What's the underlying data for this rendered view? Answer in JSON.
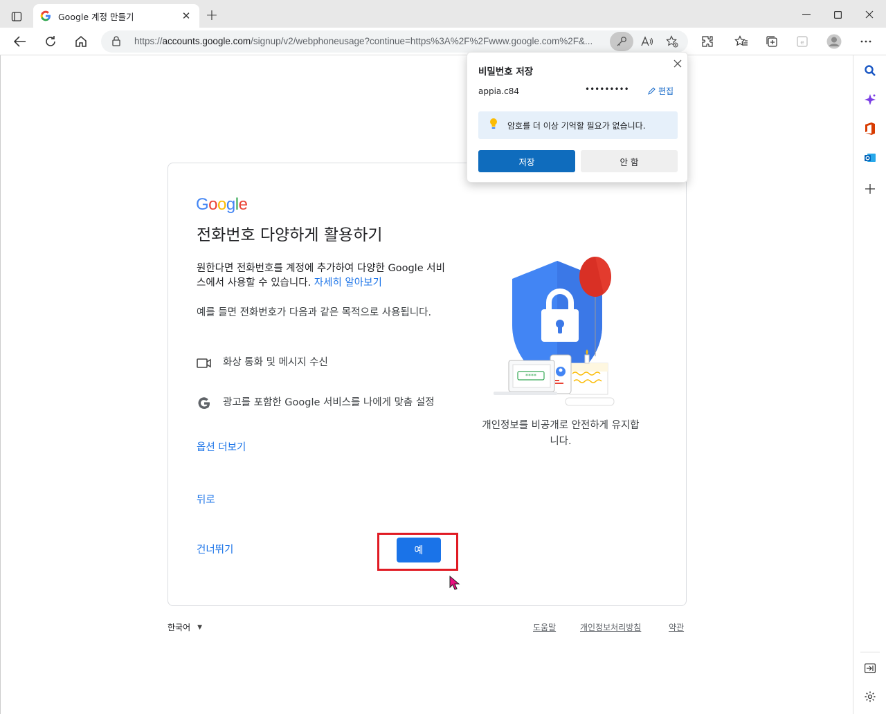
{
  "tab": {
    "title": "Google 계정 만들기"
  },
  "address": {
    "url_prefix": "https://",
    "url_host": "accounts.google.com",
    "url_rest": "/signup/v2/webphoneusage?continue=https%3A%2F%2Fwww.google.com%2F&..."
  },
  "page": {
    "logo": "Google",
    "heading": "전화번호 다양하게 활용하기",
    "intro": "원한다면 전화번호를 계정에 추가하여 다양한 Google 서비스에서 사용할 수 있습니다.",
    "learn_more": "자세히 알아보기",
    "example": "예를 들면 전화번호가 다음과 같은 목적으로 사용됩니다.",
    "features": [
      {
        "icon": "video-camera-icon",
        "label": "화상 통화 및 메시지 수신"
      },
      {
        "icon": "google-g-icon",
        "label": "광고를 포함한 Google 서비스를 나에게 맞춤 설정"
      }
    ],
    "more_options": "옵션 더보기",
    "back": "뒤로",
    "skip": "건너뛰기",
    "yes": "예",
    "caption": "개인정보를 비공개로 안전하게 유지합니다.",
    "illustration_code": "****"
  },
  "footer": {
    "language": "한국어",
    "help": "도움말",
    "privacy": "개인정보처리방침",
    "terms": "약관"
  },
  "password_popup": {
    "title": "비밀번호 저장",
    "username": "appia.c84",
    "password_mask": "•••••••••",
    "edit": "편집",
    "info": "암호를 더 이상 기억할 필요가 없습니다.",
    "save": "저장",
    "no": "안 함"
  },
  "colors": {
    "google_blue": "#1a73e8",
    "highlight_red": "#e01b24",
    "edge_save_blue": "#0f6cbd"
  }
}
